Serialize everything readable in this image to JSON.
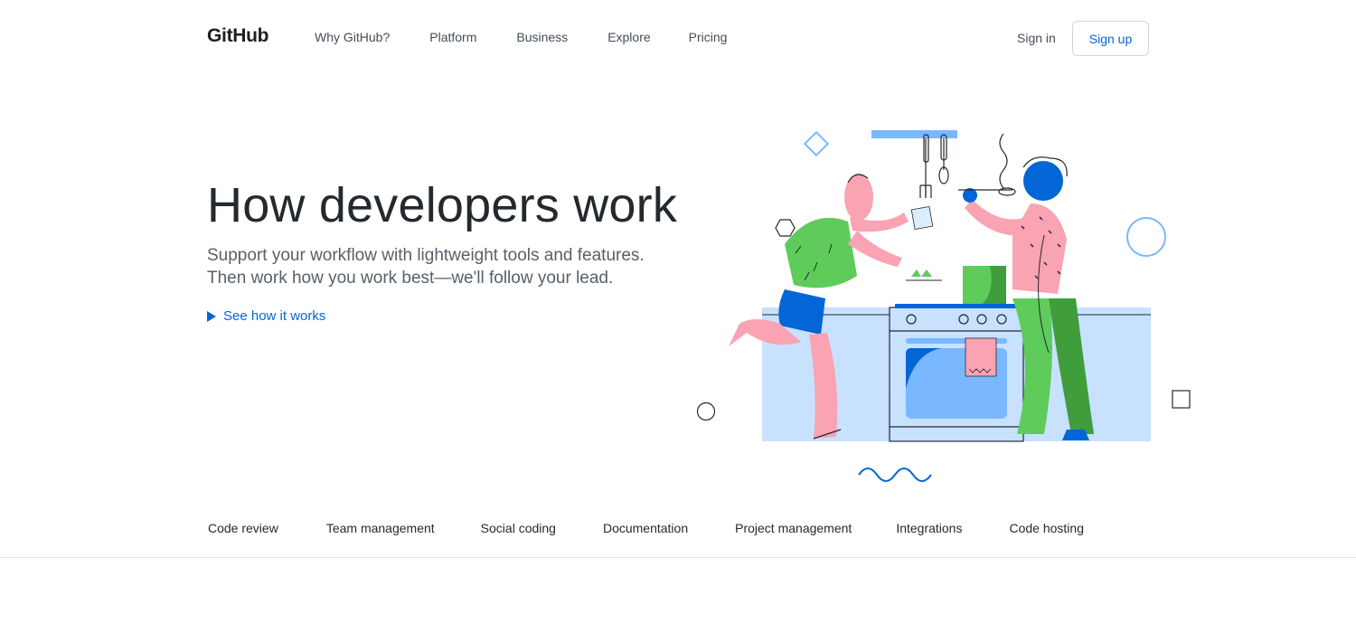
{
  "header": {
    "logo": "GitHub",
    "nav": [
      "Why GitHub?",
      "Platform",
      "Business",
      "Explore",
      "Pricing"
    ],
    "sign_in": "Sign in",
    "sign_up": "Sign up"
  },
  "hero": {
    "title": "How developers work",
    "subtitle_lines": [
      "Support your workflow with lightweight tools and features.",
      "Then work how you work best—we'll follow your lead."
    ],
    "cta": "See how it works"
  },
  "tabs": [
    "Code review",
    "Team management",
    "Social coding",
    "Documentation",
    "Project management",
    "Integrations",
    "Code hosting"
  ],
  "colors": {
    "link": "#0366d6",
    "kitchen": "#c8e1ff",
    "pink": "#f9a3b3",
    "green": "#5fcb5b",
    "blue_person": "#0366d6"
  }
}
